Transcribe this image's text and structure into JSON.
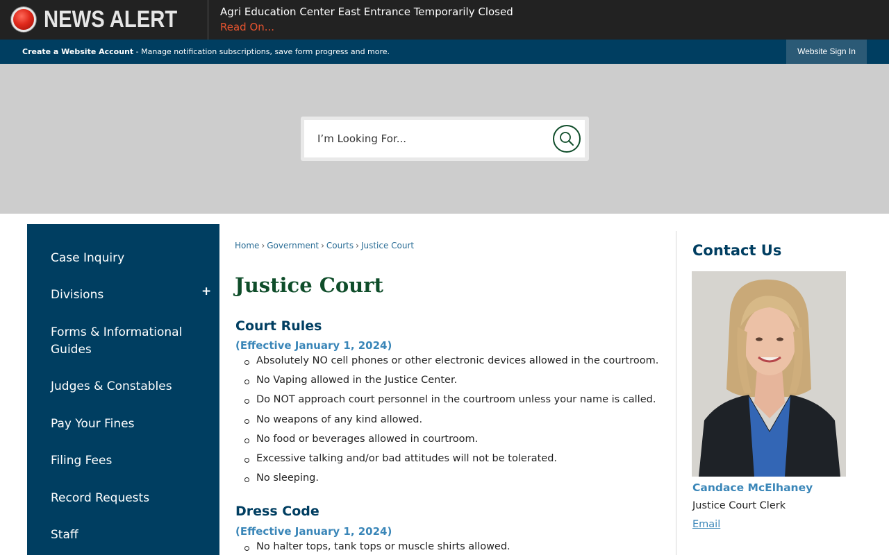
{
  "alert": {
    "label": "NEWS ALERT",
    "headline": "Agri Education Center East Entrance Temporarily Closed",
    "read_on": "Read On..."
  },
  "account_bar": {
    "create_account": "Create a Website Account",
    "description": " - Manage notification subscriptions, save form progress and more.",
    "sign_in": "Website Sign In"
  },
  "search": {
    "placeholder": "I’m Looking For..."
  },
  "sidebar": {
    "items": [
      {
        "label": "Case Inquiry"
      },
      {
        "label": "Divisions",
        "expand": "+"
      },
      {
        "label": "Forms & Informational Guides"
      },
      {
        "label": "Judges & Constables"
      },
      {
        "label": "Pay Your Fines"
      },
      {
        "label": "Filing Fees"
      },
      {
        "label": "Record Requests"
      },
      {
        "label": "Staff"
      }
    ]
  },
  "breadcrumb": [
    "Home",
    "Government",
    "Courts",
    "Justice Court"
  ],
  "main": {
    "title": "Justice Court",
    "court_rules": {
      "heading": "Court Rules",
      "effective": "(Effective January 1, 2024)",
      "items": [
        "Absolutely NO cell phones or other electronic devices allowed in the courtroom.",
        "No Vaping allowed in the Justice Center.",
        "Do NOT approach court personnel in the courtroom unless your name is called.",
        "No weapons of any kind allowed.",
        "No food or beverages allowed in courtroom.",
        "Excessive talking and/or bad attitudes will not be tolerated.",
        "No sleeping."
      ]
    },
    "dress_code": {
      "heading": "Dress Code",
      "effective": "(Effective January 1, 2024)",
      "items": [
        "No halter tops, tank tops or muscle shirts allowed."
      ]
    }
  },
  "contact": {
    "title": "Contact Us",
    "name": "Candace McElhaney",
    "role": "Justice Court Clerk",
    "email": "Email"
  },
  "colors": {
    "navy": "#003e61",
    "green": "#0f4d2a",
    "link_blue": "#3a86b8",
    "alert_orange": "#e8542f"
  }
}
